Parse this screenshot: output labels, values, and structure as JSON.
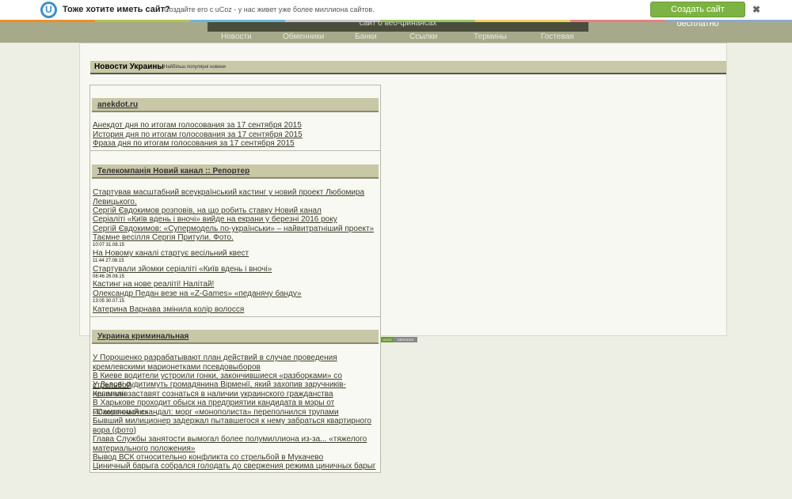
{
  "promo": {
    "logo": "U",
    "question": "Тоже хотите иметь сайт?",
    "subtitle": "Создайте его с uCoz -  у нас живет уже более миллиона сайтов.",
    "create_button": "Создать сайт бесплатно",
    "close": "✖"
  },
  "header": {
    "banner_text": "сайт о веб-финансах",
    "nav": [
      "Новости",
      "Обменники",
      "Банки",
      "Ссылки",
      "Термины",
      "Гостевая"
    ]
  },
  "section": {
    "title": "Новости Украины",
    "subtitle": "Найбільш популярні новини"
  },
  "feeds": [
    {
      "title": "anekdot.ru",
      "items": [
        "Анекдот дня по итогам голосования за 17 сентября 2015",
        "История дня по итогам голосования за 17 сентября 2015",
        "Фраза дня по итогам голосования за 17 сентября 2015"
      ]
    },
    {
      "title": "Телекомпанія Новий канал :: Репортер",
      "items": [
        "Стартував масштабний всеукраїнський кастинг у новий проект Любомира Левицького.",
        "Сергій Євдокимов розповів, на що робить ставку Новий канал",
        "Серіаліті «Київ вдень і вночі» вийде на екрани у березні 2016 року",
        "Сергій Євдокимов: «Супермодель по-українськи» – найвитратніший проект»",
        "Таємне весілля Сергія Притули. Фото.",
        "На Новому каналі стартує весільний квест",
        "Стартували зйомки серіаліті «Київ вдень і вночі»",
        "Кастинг на нове реаліті! Налітай!",
        "Олександр Педан везе на «Z-Games» «педанячу банду»",
        "Катерина Варнава змінила колір волосся"
      ],
      "dates": [
        "10:07 31.08.15",
        "11:44 27.08.15",
        "08:46 26.08.15",
        "13:05 30.07.15"
      ]
    },
    {
      "title": "Украина криминальная",
      "items": [
        "У Порошенко разрабатывают план действий в случае проведения кремлевскими марионетками псевдовыборов",
        "В Киеве водители устроили гонки, закончившиеся «разборками» со стрельбой",
        "У Львові судитимуть громадянина Вірменії, який захопив заручників-нелегалів",
        "Крымчан заставят сознаться в наличии украинского гражданства",
        "В Харькове проходит обыск на предприятии кандидата в мэры от «Самопомочи»",
        "Похоронный скандал: морг «монополиста» переполнился трупами",
        "Бывший милиционер задержал пытавшегося к нему забраться квартирного вора (фото)",
        "Глава Службы занятости вымогал более полумиллиона из-за... «тяжелого материального положения»",
        "Вывод ВСК относительно конфликта со стрельбой в Мукачево",
        "Циничный барыга собрался голодать до свержения режима циничных барыг"
      ]
    }
  ],
  "badge": {
    "left": "UCOZ",
    "right": "SERVICES"
  }
}
